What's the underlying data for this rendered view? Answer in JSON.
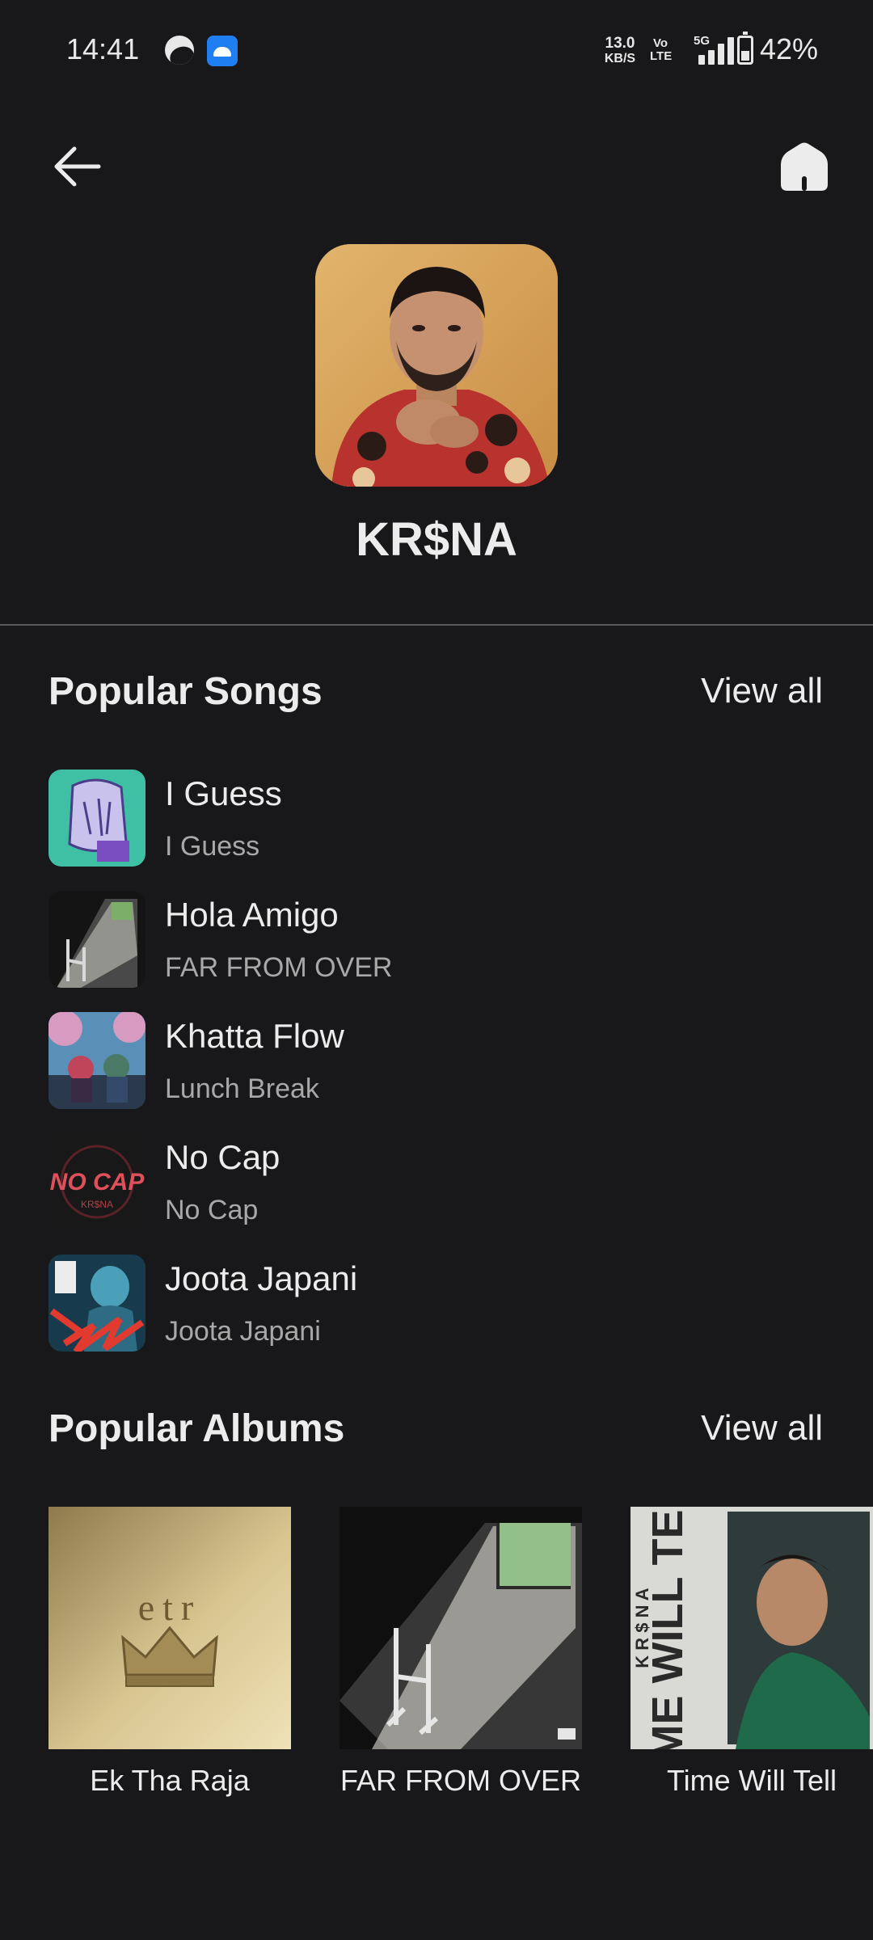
{
  "status_bar": {
    "time": "14:41",
    "net_speed_value": "13.0",
    "net_speed_unit": "KB/S",
    "volte_top": "Vo",
    "volte_bottom": "LTE",
    "network": "5G",
    "battery": "42%"
  },
  "header": {
    "back_icon": "arrow-left-icon",
    "home_icon": "home-icon"
  },
  "artist": {
    "name": "KR$NA"
  },
  "popular_songs": {
    "title": "Popular Songs",
    "view_all": "View all",
    "items": [
      {
        "title": "I Guess",
        "subtitle": "I Guess"
      },
      {
        "title": "Hola Amigo",
        "subtitle": "FAR FROM OVER"
      },
      {
        "title": "Khatta Flow",
        "subtitle": "Lunch Break"
      },
      {
        "title": "No Cap",
        "subtitle": "No Cap"
      },
      {
        "title": "Joota Japani",
        "subtitle": "Joota Japani"
      }
    ]
  },
  "popular_albums": {
    "title": "Popular Albums",
    "view_all": "View all",
    "items": [
      {
        "title": "Ek Tha Raja",
        "cover_text": "etr"
      },
      {
        "title": "FAR FROM OVER"
      },
      {
        "title": "Time Will Tell",
        "cover_text": "TIME WILL TELL",
        "cover_artist": "K R $ N A"
      }
    ]
  },
  "colors": {
    "background": "#18181a",
    "text": "#ececec",
    "subtext": "#a8a8a8",
    "divider": "#5a5a5c"
  }
}
